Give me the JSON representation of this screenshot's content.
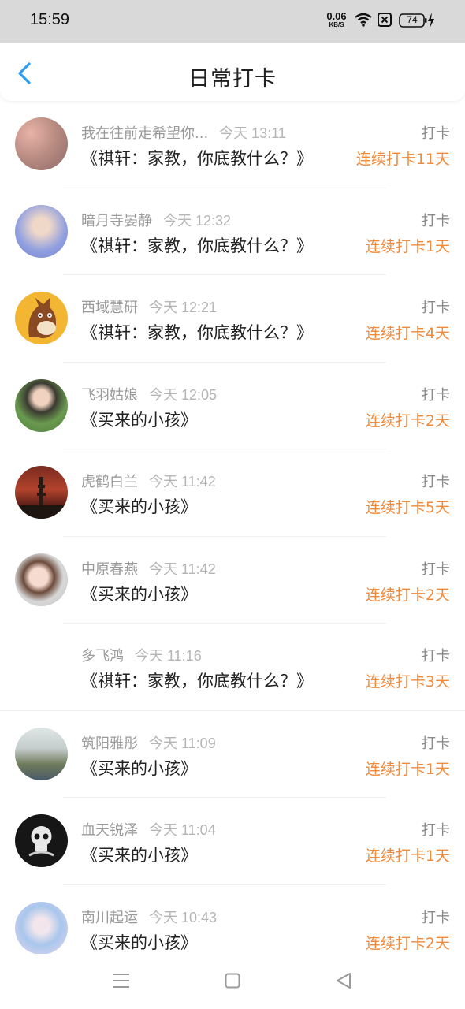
{
  "status_bar": {
    "time": "15:59",
    "net_speed": "0.06",
    "net_unit": "KB/S",
    "battery": "74",
    "icons": [
      "wifi-icon",
      "close-box-icon",
      "battery-charging-icon"
    ]
  },
  "header": {
    "title": "日常打卡",
    "back_icon": "chevron-left-icon",
    "accent": "#2a9df4"
  },
  "colors": {
    "streak": "#f08a3c",
    "name": "#9a9a9a",
    "title": "#222222"
  },
  "list": [
    {
      "name": "我在往前走希望你...",
      "time": "今天 13:11",
      "book": "《祺轩：家教，你底教什么？》",
      "checkin": "打卡",
      "streak": "连续打卡11天"
    },
    {
      "name": "暗月寺晏静",
      "time": "今天 12:32",
      "book": "《祺轩：家教，你底教什么？》",
      "checkin": "打卡",
      "streak": "连续打卡1天"
    },
    {
      "name": "西域慧研",
      "time": "今天 12:21",
      "book": "《祺轩：家教，你底教什么？》",
      "checkin": "打卡",
      "streak": "连续打卡4天"
    },
    {
      "name": "飞羽姑娘",
      "time": "今天 12:05",
      "book": "《买来的小孩》",
      "checkin": "打卡",
      "streak": "连续打卡2天"
    },
    {
      "name": "虎鹤白兰",
      "time": "今天 11:42",
      "book": "《买来的小孩》",
      "checkin": "打卡",
      "streak": "连续打卡5天"
    },
    {
      "name": "中原春燕",
      "time": "今天 11:42",
      "book": "《买来的小孩》",
      "checkin": "打卡",
      "streak": "连续打卡2天"
    },
    {
      "name": "多飞鸿",
      "time": "今天 11:16",
      "book": "《祺轩：家教，你底教什么？》",
      "checkin": "打卡",
      "streak": "连续打卡3天"
    },
    {
      "name": "筑阳雅彤",
      "time": "今天 11:09",
      "book": "《买来的小孩》",
      "checkin": "打卡",
      "streak": "连续打卡1天"
    },
    {
      "name": "血天锐泽",
      "time": "今天 11:04",
      "book": "《买来的小孩》",
      "checkin": "打卡",
      "streak": "连续打卡1天"
    },
    {
      "name": "南川起运",
      "time": "今天 10:43",
      "book": "《买来的小孩》",
      "checkin": "打卡",
      "streak": "连续打卡2天"
    }
  ],
  "nav_bar": {
    "icons": [
      "menu-icon",
      "home-square-icon",
      "back-triangle-icon"
    ]
  }
}
